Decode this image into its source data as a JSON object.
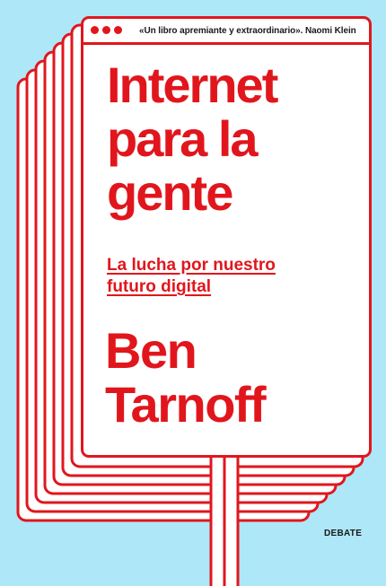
{
  "book": {
    "quote": "«Un libro apremiante y extraordinario». Naomi Klein",
    "title_line1": "Internet",
    "title_line2": "para la",
    "title_line3": "gente",
    "subtitle_line1": "La lucha por nuestro",
    "subtitle_line2": "futuro digital",
    "author_line1": "Ben",
    "author_line2": "Tarnoff",
    "publisher": "DEBATE"
  },
  "colors": {
    "background": "#aee7f7",
    "accent": "#e1161d",
    "window": "#ffffff"
  }
}
